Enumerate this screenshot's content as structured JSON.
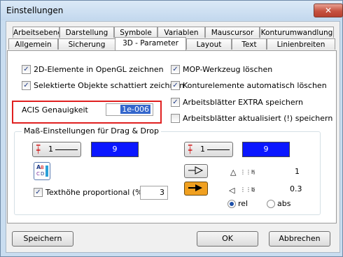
{
  "window": {
    "title": "Einstellungen",
    "close_glyph": "✕"
  },
  "tabs_row1": [
    "Arbeitsebene",
    "Darstellung",
    "Symbole",
    "Variablen",
    "Mauscursor",
    "Konturumwandlung"
  ],
  "tabs_row2": [
    "Allgemein",
    "Sicherung",
    "3D - Parameter",
    "Layout",
    "Text",
    "Linienbreiten"
  ],
  "active_tab": "3D - Parameter",
  "options_left": [
    {
      "label": "2D-Elemente in OpenGL zeichnen",
      "checked": true
    },
    {
      "label": "Selektierte Objekte schattiert zeichnen",
      "checked": true
    }
  ],
  "options_right": [
    {
      "label": "MOP-Werkzeug löschen",
      "checked": true
    },
    {
      "label": "Konturelemente automatisch löschen",
      "checked": true
    },
    {
      "label": "Arbeitsblätter EXTRA speichern",
      "checked": true
    },
    {
      "label": "Arbeitsblätter aktualisiert (!) speichern",
      "checked": false
    }
  ],
  "acis": {
    "label": "ACIS Genauigkeit",
    "value": "1e-006"
  },
  "group": {
    "title": "Maß-Einstellungen für Drag & Drop",
    "left_line_value": "1",
    "left_color_value": "9",
    "right_line_value": "1",
    "right_color_value": "9",
    "text_height_label": "Texthöhe proportional (%)",
    "text_height_checked": true,
    "text_height_value": "3",
    "h_label": "h",
    "h_value": "1",
    "b_label": "b",
    "b_value": "0.3",
    "radio_rel": "rel",
    "radio_abs": "abs",
    "selected_radio": "rel"
  },
  "buttons": {
    "save": "Speichern",
    "ok": "OK",
    "cancel": "Abbrechen"
  },
  "colors": {
    "accent_blue": "#0b17ff",
    "highlight_red": "#e02020",
    "arrow_orange": "#f0a020"
  }
}
